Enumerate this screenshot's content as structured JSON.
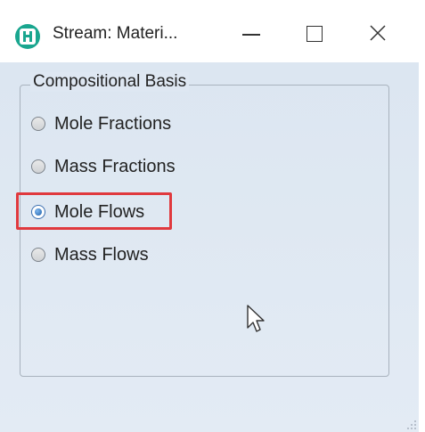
{
  "window": {
    "title": "Stream: Materi...",
    "controls": {
      "minimize": "minimize-icon",
      "maximize": "maximize-icon",
      "close": "close-icon"
    }
  },
  "group": {
    "legend": "Compositional Basis",
    "options": [
      {
        "label": "Mole Fractions",
        "checked": false
      },
      {
        "label": "Mass Fractions",
        "checked": false
      },
      {
        "label": "Mole Flows",
        "checked": true
      },
      {
        "label": "Mass Flows",
        "checked": false
      }
    ]
  },
  "colors": {
    "highlight": "#e0393e",
    "app_icon": "#19a68f",
    "client_bg": "#dce6f1"
  }
}
